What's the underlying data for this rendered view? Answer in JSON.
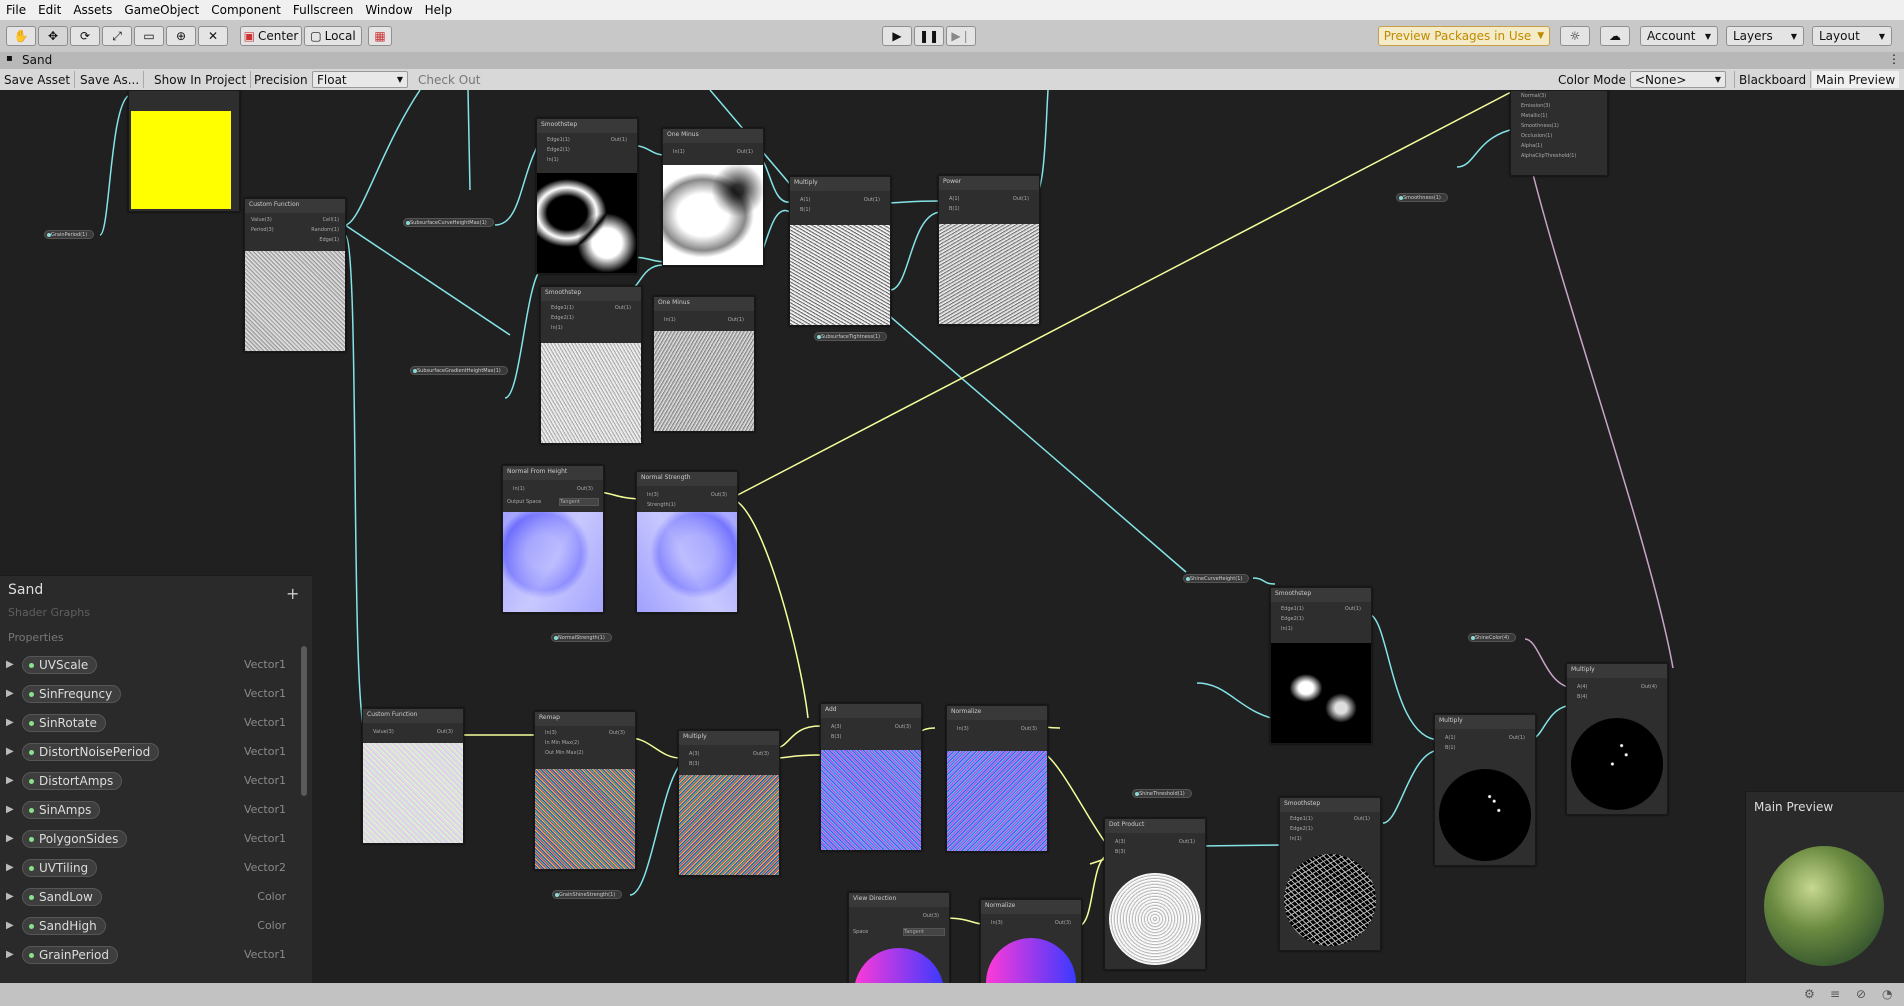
{
  "menu": [
    "File",
    "Edit",
    "Assets",
    "GameObject",
    "Component",
    "Fullscreen",
    "Window",
    "Help"
  ],
  "toolbar": {
    "center_label": "Center",
    "local_label": "Local",
    "preview_packages": "Preview Packages in Use",
    "account": "Account",
    "layers": "Layers",
    "layout": "Layout"
  },
  "tab": {
    "title": "Sand"
  },
  "graph_toolbar": {
    "save_asset": "Save Asset",
    "save_as": "Save As...",
    "show_in_project": "Show In Project",
    "precision_label": "Precision",
    "precision_value": "Float",
    "check_out": "Check Out",
    "color_mode_label": "Color Mode",
    "color_mode_value": "<None>",
    "blackboard": "Blackboard",
    "main_preview": "Main Preview"
  },
  "nodes": {
    "custom_function_1": {
      "title": "Custom Function",
      "ports": [
        "Value(3)",
        "Period(3)",
        "Cell(1)",
        "Random(1)",
        "Edge(1)"
      ]
    },
    "smoothstep_1": {
      "title": "Smoothstep",
      "ports": [
        "Edge1(1)",
        "Edge2(1)",
        "In(1)",
        "Out(1)"
      ]
    },
    "one_minus_1": {
      "title": "One Minus",
      "ports": [
        "In(1)",
        "Out(1)"
      ]
    },
    "multiply_1": {
      "title": "Multiply",
      "ports": [
        "A(1)",
        "B(1)",
        "Out(1)"
      ]
    },
    "power_1": {
      "title": "Power",
      "ports": [
        "A(1)",
        "B(1)",
        "Out(1)"
      ]
    },
    "smoothstep_2": {
      "title": "Smoothstep",
      "ports": [
        "Edge1(1)",
        "Edge2(1)",
        "In(1)",
        "Out(1)"
      ]
    },
    "one_minus_2": {
      "title": "One Minus",
      "ports": [
        "In(1)",
        "Out(1)"
      ]
    },
    "normal_from_height": {
      "title": "Normal From Height",
      "ports": [
        "In(1)",
        "Out(3)"
      ],
      "output_space_label": "Output Space",
      "output_space_value": "Tangent"
    },
    "normal_strength": {
      "title": "Normal Strength",
      "ports": [
        "In(3)",
        "Strength(1)",
        "Out(3)"
      ]
    },
    "custom_function_2": {
      "title": "Custom Function",
      "ports": [
        "Value(3)",
        "Out(3)"
      ]
    },
    "remap": {
      "title": "Remap",
      "ports": [
        "In(3)",
        "In Min Max(2)",
        "Out Min Max(2)",
        "Out(3)"
      ]
    },
    "multiply_2": {
      "title": "Multiply",
      "ports": [
        "A(3)",
        "B(3)",
        "Out(3)"
      ]
    },
    "add": {
      "title": "Add",
      "ports": [
        "A(3)",
        "B(3)",
        "Out(3)"
      ]
    },
    "normalize_1": {
      "title": "Normalize",
      "ports": [
        "In(3)",
        "Out(3)"
      ]
    },
    "view_direction": {
      "title": "View Direction",
      "ports": [
        "Out(3)"
      ],
      "space_label": "Space",
      "space_value": "Tangent"
    },
    "normalize_2": {
      "title": "Normalize",
      "ports": [
        "In(3)",
        "Out(3)"
      ]
    },
    "dot_product": {
      "title": "Dot Product",
      "ports": [
        "A(3)",
        "B(3)",
        "Out(1)"
      ]
    },
    "smoothstep_3": {
      "title": "Smoothstep",
      "ports": [
        "Edge1(1)",
        "Edge2(1)",
        "In(1)",
        "Out(1)"
      ]
    },
    "smoothstep_4": {
      "title": "Smoothstep",
      "ports": [
        "Edge1(1)",
        "Edge2(1)",
        "In(1)",
        "Out(1)"
      ]
    },
    "multiply_3": {
      "title": "Multiply",
      "ports": [
        "A(1)",
        "B(1)",
        "Out(1)"
      ]
    },
    "multiply_4": {
      "title": "Multiply",
      "ports": [
        "A(4)",
        "B(4)",
        "Out(4)"
      ]
    },
    "master": {
      "ports": [
        "Normal(3)",
        "Emission(3)",
        "Metallic(1)",
        "Smoothness(1)",
        "Occlusion(1)",
        "Alpha(1)",
        "AlphaClipThreshold(1)"
      ]
    }
  },
  "property_pills": {
    "grain_period": "GrainPeriod(1)",
    "subsurface_curve_height_max": "SubsurfaceCurveHeightMax(1)",
    "subsurface_gradient_height_max": "SubsurfaceGradientHeightMax(1)",
    "subsurface_tightness": "SubsurfaceTightness(1)",
    "normal_strength": "NormalStrength(1)",
    "grain_shine_strength": "GrainShineStrength(1)",
    "shine_curve_height": "ShineCurveHeight(1)",
    "shine_threshold": "ShineThreshold(1)",
    "shine_color": "ShineColor(4)",
    "smoothness": "Smoothness(1)"
  },
  "blackboard": {
    "title": "Sand",
    "subtitle": "Shader Graphs",
    "section": "Properties",
    "add": "+",
    "properties": [
      {
        "name": "UVScale",
        "type": "Vector1"
      },
      {
        "name": "SinFrequncy",
        "type": "Vector1"
      },
      {
        "name": "SinRotate",
        "type": "Vector1"
      },
      {
        "name": "DistortNoisePeriod",
        "type": "Vector1"
      },
      {
        "name": "DistortAmps",
        "type": "Vector1"
      },
      {
        "name": "SinAmps",
        "type": "Vector1"
      },
      {
        "name": "PolygonSides",
        "type": "Vector1"
      },
      {
        "name": "UVTiling",
        "type": "Vector2"
      },
      {
        "name": "SandLow",
        "type": "Color"
      },
      {
        "name": "SandHigh",
        "type": "Color"
      },
      {
        "name": "GrainPeriod",
        "type": "Vector1"
      }
    ]
  },
  "main_preview_panel": {
    "title": "Main Preview"
  },
  "colors": {
    "accent_yellow": "#ffff00",
    "preview_packages_text": "#c08a00",
    "wire_float": "#84e4e7",
    "wire_vector": "#f6ff9a",
    "wire_color": "#c8a4c8"
  }
}
